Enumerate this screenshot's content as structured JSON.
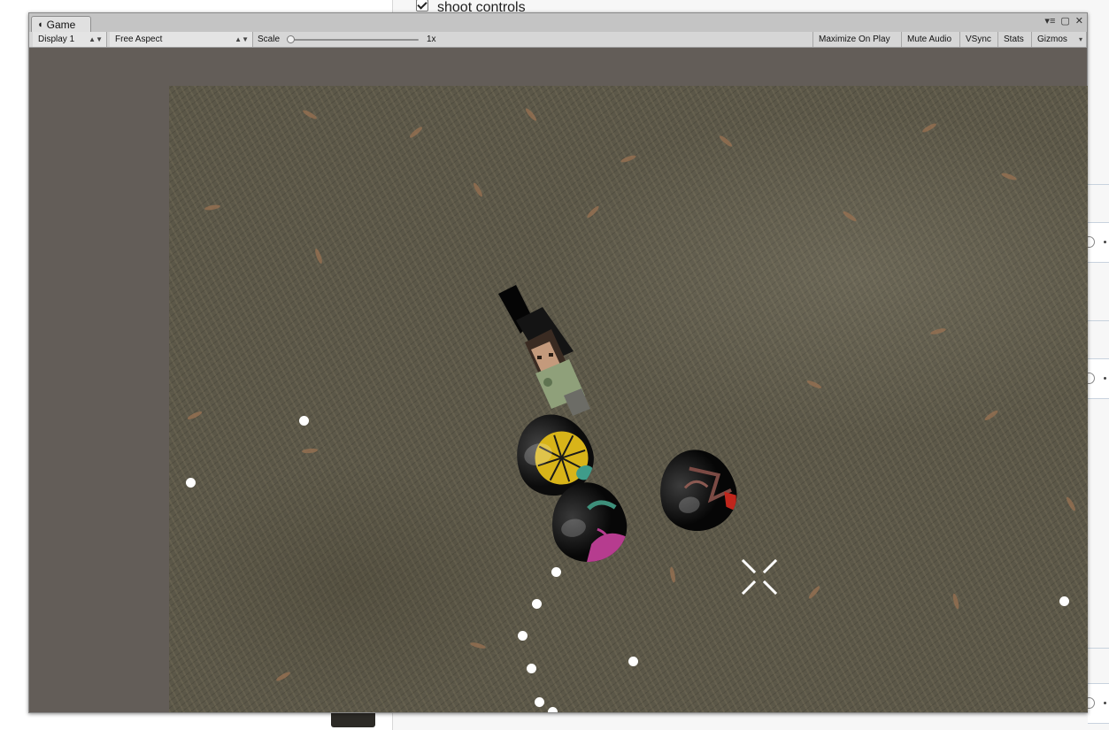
{
  "background": {
    "checkbox_label": "shoot controls",
    "checkbox_checked": true
  },
  "window": {
    "tab_label": "Game",
    "tab_icon": "pacman-icon",
    "controls": [
      "window-menu-icon",
      "maximize-icon",
      "close-icon"
    ]
  },
  "toolbar": {
    "display": "Display 1",
    "aspect": "Free Aspect",
    "scale_label": "Scale",
    "scale_value": "1x",
    "maximize_on_play": "Maximize On Play",
    "mute_audio": "Mute Audio",
    "vsync": "VSync",
    "stats": "Stats",
    "gizmos": "Gizmos"
  },
  "scene": {
    "objects": [
      "character-figure",
      "egg-yellow",
      "egg-pink",
      "egg-red",
      "crosshair-icon"
    ],
    "waypoints_visible": 10,
    "colors": {
      "ground": "#5b5748",
      "waypoint": "#ffffff",
      "window_bg": "#635d58"
    }
  }
}
